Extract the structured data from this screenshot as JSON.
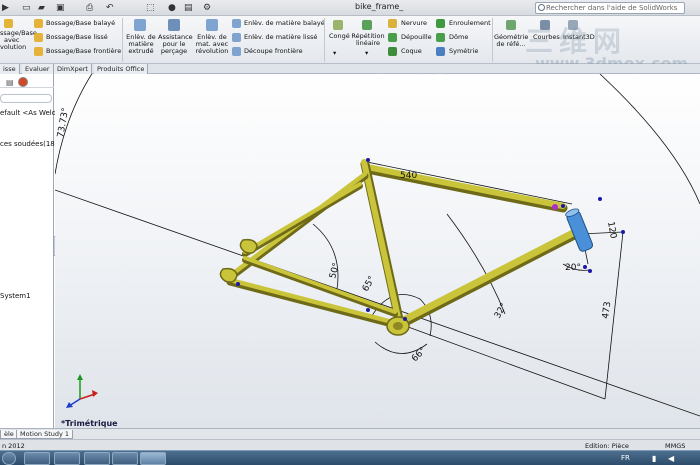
{
  "titlebar": {
    "doc_title": "bike_frame_",
    "search_placeholder": "Rechercher dans l'aide de SolidWorks"
  },
  "ribbon": {
    "boss_left": [
      "ssage/Base",
      "avec",
      "volution"
    ],
    "boss_items": [
      "Bossage/Base balayé",
      "Bossage/Base lissé",
      "Bossage/Base frontière"
    ],
    "extrude_cut": [
      "Enlèv. de",
      "matière",
      "extrudé"
    ],
    "hole_wizard": [
      "Assistance",
      "pour le",
      "perçage"
    ],
    "revolve_cut": [
      "Enlèv. de",
      "mat. avec",
      "révolution"
    ],
    "cut_items": [
      "Enlèv. de matière balayé",
      "Enlèv. de matière lissé",
      "Découpe frontière"
    ],
    "fillet": "Congé",
    "pattern": [
      "Répétition",
      "linéaire"
    ],
    "features_a": [
      "Nervure",
      "Dépouille",
      "Coque"
    ],
    "features_b": [
      "Enroulement",
      "Dôme",
      "Symétrie"
    ],
    "geometry": [
      "Géométrie",
      "de réfé..."
    ],
    "curves": "Courbes",
    "instant3d": "Instant3D"
  },
  "command_tabs": [
    "isse",
    "Evaluer",
    "DimXpert",
    "Produits Office"
  ],
  "tree": {
    "items": [
      "efault <As Welde",
      "ces soudées(18)",
      "System1"
    ]
  },
  "viewport": {
    "view_name": "*Trimétrique",
    "dimensions": [
      "540",
      "120",
      "473",
      "20°",
      "50°",
      "65°",
      "32°",
      "66°",
      "73.73°"
    ]
  },
  "bottom_tabs": [
    "èle",
    "Motion Study 1"
  ],
  "status": {
    "left": "n 2012",
    "mode": "Edition: Pièce",
    "units": "MMGS"
  },
  "taskbar": {
    "lang": "FR"
  },
  "watermark": {
    "line1": "三维网",
    "line2": "www.3dmox.com"
  },
  "colors": {
    "tube": "#c9c43a",
    "tube_shadow": "#6e6a18",
    "headtube": "#4a90d8",
    "dim_lines": "#111111"
  }
}
